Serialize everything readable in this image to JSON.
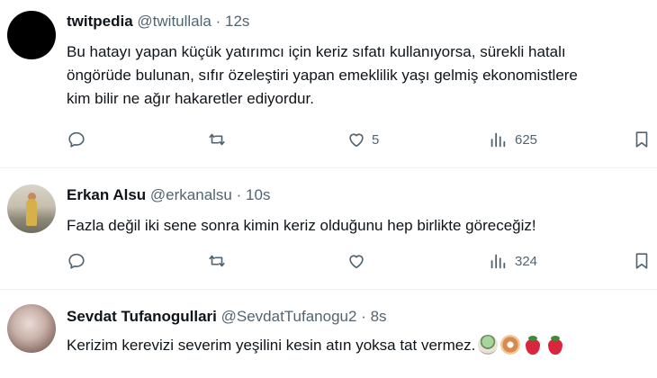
{
  "tweets": [
    {
      "name": "twitpedia",
      "handle": "@twitullala",
      "time": "12s",
      "text_lines": [
        "Bu hatayı yapan küçük yatırımcı için keriz sıfatı kullanıyorsa, sürekli hatalı",
        "öngörüde bulunan, sıfır özeleştiri yapan emeklilik yaşı gelmiş ekonomistlere",
        "kim bilir ne ağır hakaretler ediyordur."
      ],
      "likes": "5",
      "views": "625"
    },
    {
      "name": "Erkan Alsu",
      "handle": "@erkanalsu",
      "time": "10s",
      "text_lines": [
        "Fazla değil iki sene sonra kimin keriz olduğunu hep birlikte göreceğiz!"
      ],
      "likes": "",
      "views": "324"
    },
    {
      "name": "Sevdat Tufanogullari",
      "handle": "@SevdatTufanogu2",
      "time": "8s",
      "text_lines": [
        "Kerizim kerevizi severim yeşilini kesin atın yoksa tat vermez."
      ],
      "emojis": [
        "matcha-cake-emoji",
        "donut-emoji",
        "strawberry-emoji",
        "strawberry-emoji"
      ]
    }
  ],
  "separator": "·",
  "colors": {
    "text": "#0f1419",
    "secondary": "#536471",
    "divider": "#eff3f4"
  }
}
